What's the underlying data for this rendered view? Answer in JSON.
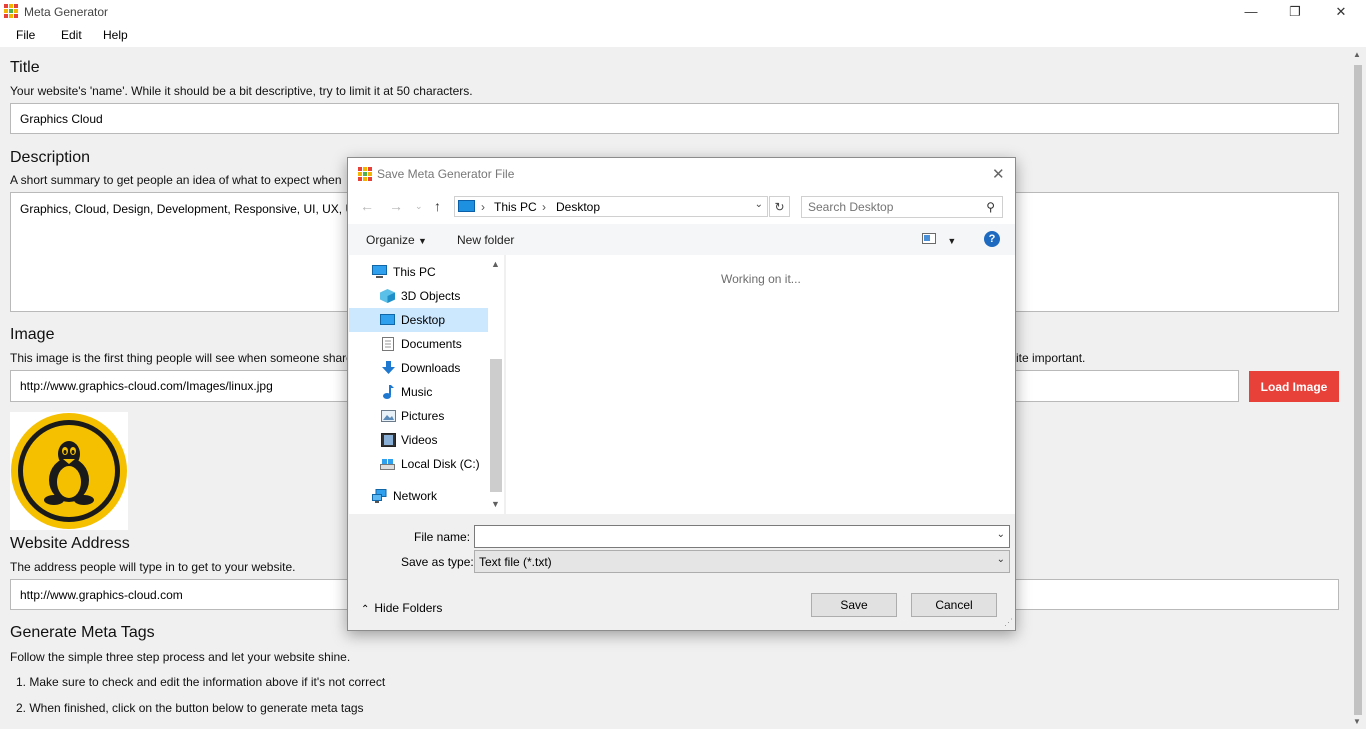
{
  "window": {
    "title": "Meta Generator",
    "controls": {
      "minimize": "—",
      "restore": "❐",
      "close": "✕"
    }
  },
  "menu": [
    "File",
    "Edit",
    "Help"
  ],
  "form": {
    "title": {
      "heading": "Title",
      "hint": "Your website's 'name'. While it should be a bit descriptive, try to limit it at 50 characters.",
      "value": "Graphics Cloud"
    },
    "description": {
      "heading": "Description",
      "hint": "A short summary to get people an idea of what to expect when",
      "value": "Graphics, Cloud, Design, Development, Responsive, UI, UX, UI/"
    },
    "image": {
      "heading": "Image",
      "hint": "This image is the first thing people will see when someone share",
      "hint_tail": "ite important.",
      "value": "http://www.graphics-cloud.com/Images/linux.jpg",
      "button": "Load Image",
      "button_color": "#e8413a"
    },
    "address": {
      "heading": "Website Address",
      "hint": "The address people will type in to get to your website.",
      "value": "http://www.graphics-cloud.com"
    },
    "generate": {
      "heading": "Generate Meta Tags",
      "intro": "Follow the simple three step process and let your website shine.",
      "steps": [
        "1. Make sure to check and edit the information above if it's not correct",
        "2. When finished, click on the button below to generate meta tags"
      ]
    }
  },
  "dialog": {
    "title": "Save Meta Generator File",
    "breadcrumb": [
      "This PC",
      "Desktop"
    ],
    "search_placeholder": "Search Desktop",
    "toolbar": {
      "organize": "Organize",
      "new_folder": "New folder"
    },
    "nav_items": [
      {
        "label": "This PC",
        "icon": "computer-icon",
        "selected": false
      },
      {
        "label": "3D Objects",
        "icon": "cube-icon",
        "selected": false
      },
      {
        "label": "Desktop",
        "icon": "desktop-icon",
        "selected": true
      },
      {
        "label": "Documents",
        "icon": "document-icon",
        "selected": false
      },
      {
        "label": "Downloads",
        "icon": "download-icon",
        "selected": false
      },
      {
        "label": "Music",
        "icon": "music-icon",
        "selected": false
      },
      {
        "label": "Pictures",
        "icon": "picture-icon",
        "selected": false
      },
      {
        "label": "Videos",
        "icon": "video-icon",
        "selected": false
      },
      {
        "label": "Local Disk (C:)",
        "icon": "disk-icon",
        "selected": false
      },
      {
        "label": "Network",
        "icon": "network-icon",
        "selected": false
      }
    ],
    "status": "Working on it...",
    "file_name_label": "File name:",
    "file_name_value": "",
    "save_type_label": "Save as type:",
    "save_type_value": "Text file (*.txt)",
    "hide_folders": "Hide Folders",
    "save": "Save",
    "cancel": "Cancel"
  }
}
